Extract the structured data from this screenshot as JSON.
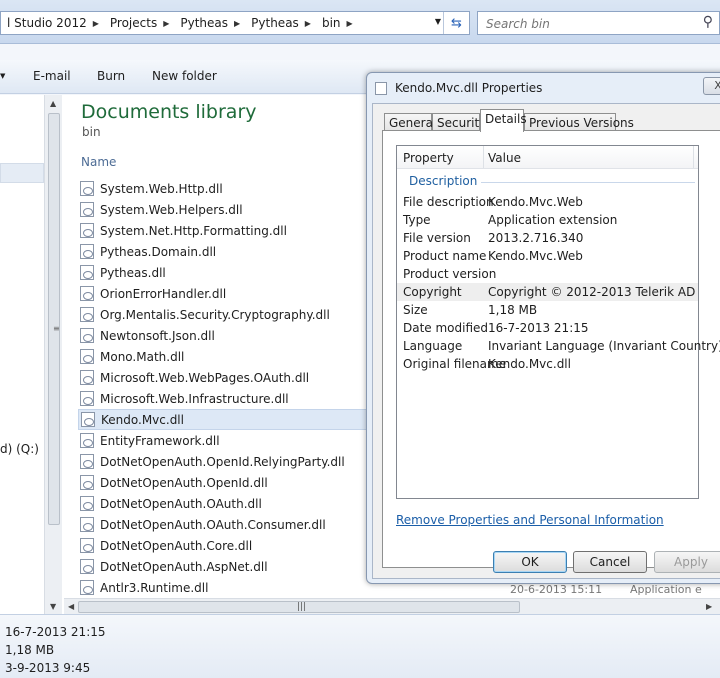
{
  "explorer": {
    "breadcrumbs": [
      "l Studio 2012",
      "Projects",
      "Pytheas",
      "Pytheas",
      "bin"
    ],
    "search": {
      "placeholder": "Search bin"
    },
    "toolbar": {
      "email": "E-mail",
      "burn": "Burn",
      "new_folder": "New folder"
    },
    "nav": {
      "drive_label": "d) (Q:)"
    },
    "library": {
      "title": "Documents library",
      "subtitle": "bin"
    },
    "columns": {
      "name": "Name"
    },
    "files": [
      "System.Web.Http.dll",
      "System.Web.Helpers.dll",
      "System.Net.Http.Formatting.dll",
      "Pytheas.Domain.dll",
      "Pytheas.dll",
      "OrionErrorHandler.dll",
      "Org.Mentalis.Security.Cryptography.dll",
      "Newtonsoft.Json.dll",
      "Mono.Math.dll",
      "Microsoft.Web.WebPages.OAuth.dll",
      "Microsoft.Web.Infrastructure.dll",
      "Kendo.Mvc.dll",
      "EntityFramework.dll",
      "DotNetOpenAuth.OpenId.RelyingParty.dll",
      "DotNetOpenAuth.OpenId.dll",
      "DotNetOpenAuth.OAuth.dll",
      "DotNetOpenAuth.OAuth.Consumer.dll",
      "DotNetOpenAuth.Core.dll",
      "DotNetOpenAuth.AspNet.dll",
      "Antlr3.Runtime.dll"
    ],
    "selected_file": "Kendo.Mvc.dll",
    "peek_date": "20-6-2013 15:11",
    "peek_type": "Application e",
    "details_pane": {
      "date": "16-7-2013 21:15",
      "size": "1,18 MB",
      "created": "3-9-2013 9:45"
    }
  },
  "dialog": {
    "title": "Kendo.Mvc.dll Properties",
    "close_label": "X",
    "tabs": [
      "General",
      "Security",
      "Details",
      "Previous Versions"
    ],
    "active_tab": "Details",
    "headers": {
      "property": "Property",
      "value": "Value"
    },
    "group": "Description",
    "rows": [
      {
        "k": "File description",
        "v": "Kendo.Mvc.Web"
      },
      {
        "k": "Type",
        "v": "Application extension"
      },
      {
        "k": "File version",
        "v": "2013.2.716.340"
      },
      {
        "k": "Product name",
        "v": "Kendo.Mvc.Web"
      },
      {
        "k": "Product version",
        "v": ""
      },
      {
        "k": "Copyright",
        "v": "Copyright © 2012-2013 Telerik AD"
      },
      {
        "k": "Size",
        "v": "1,18 MB"
      },
      {
        "k": "Date modified",
        "v": "16-7-2013 21:15"
      },
      {
        "k": "Language",
        "v": "Invariant Language (Invariant Country)"
      },
      {
        "k": "Original filename",
        "v": "Kendo.Mvc.dll"
      }
    ],
    "highlighted_row": "Copyright",
    "remove_link": "Remove Properties and Personal Information",
    "buttons": {
      "ok": "OK",
      "cancel": "Cancel",
      "apply": "Apply"
    }
  }
}
